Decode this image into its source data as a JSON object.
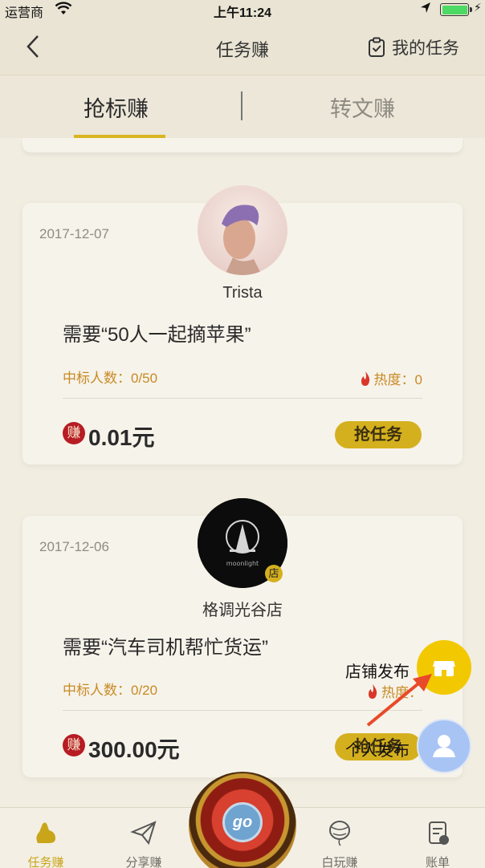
{
  "status_bar": {
    "carrier": "运营商",
    "time": "上午11:24"
  },
  "nav": {
    "title": "任务赚",
    "my_tasks": "我的任务"
  },
  "tabs": [
    {
      "label": "抢标赚",
      "active": true
    },
    {
      "label": "转文赚",
      "active": false
    }
  ],
  "cards": [
    {
      "date": "2017-12-07",
      "name": "Trista",
      "need": "需要“50人一起摘苹果”",
      "winners": "中标人数：0/50",
      "heat": "热度：0",
      "earn_badge": "赚",
      "price": "0.01元",
      "button": "抢任务"
    },
    {
      "date": "2017-12-06",
      "name": "格调光谷店",
      "store_badge": "店",
      "avatar_text": "moonlight",
      "need": "需要“汽车司机帮忙货运”",
      "winners": "中标人数：0/20",
      "heat": "热度：",
      "earn_badge": "赚",
      "price": "300.00元",
      "button": "抢任务"
    }
  ],
  "fabs": {
    "store": "店铺发布",
    "personal": "个人发布"
  },
  "tabbar": [
    {
      "label": "任务赚",
      "icon": "task-earn-icon",
      "active": true
    },
    {
      "label": "分享赚",
      "icon": "paper-plane-icon",
      "active": false
    },
    {
      "label": "go",
      "icon": "go-wheel-icon",
      "active": false
    },
    {
      "label": "白玩赚",
      "icon": "balloon-icon",
      "active": false
    },
    {
      "label": "账单",
      "icon": "bill-icon",
      "active": false
    }
  ],
  "colors": {
    "accent": "#d5b01e",
    "highlight_text": "#c88a24",
    "earn_badge": "#b71c24",
    "fab_store": "#f2c800",
    "fab_personal": "#a8c4f4"
  }
}
